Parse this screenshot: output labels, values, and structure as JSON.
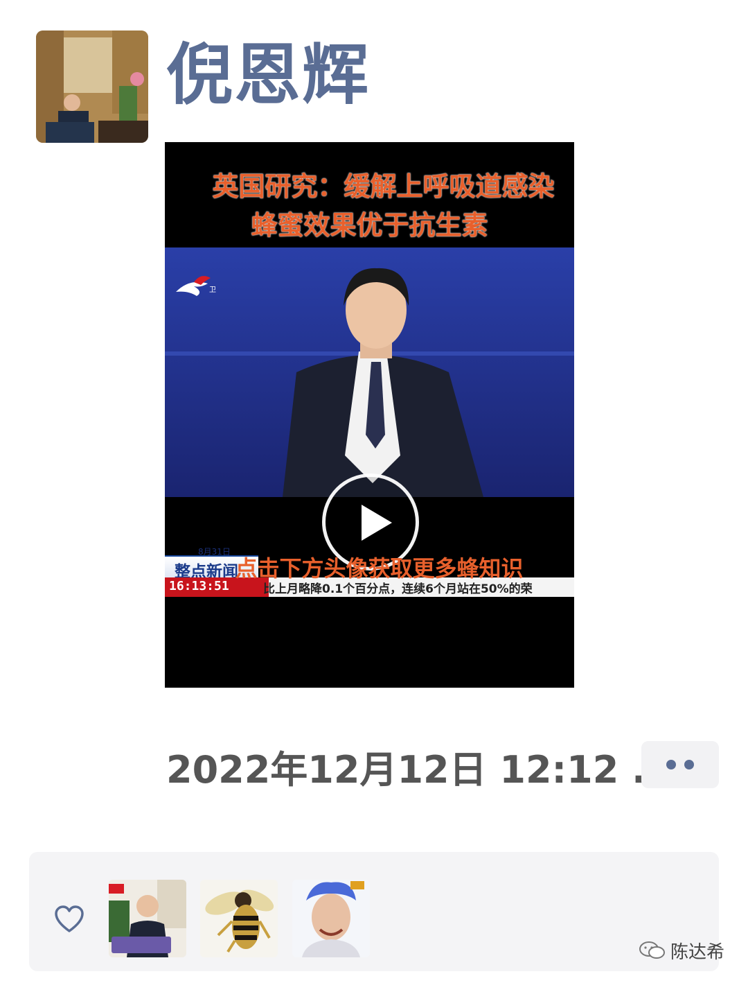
{
  "post": {
    "author": "倪恩辉",
    "timestamp": "2022年12月12日 12:12 ...",
    "avatar_icon": "person-avatar"
  },
  "video": {
    "headline_line1": "英国研究：缓解上呼吸道感染",
    "headline_line2": "蜂蜜效果优于抗生素",
    "news_date": "8月31日",
    "news_program": "整点新闻",
    "ticker_time": "16:13:51",
    "ticker_text": "比上月略降0.1个百分点，连续6个月站在50%的荣",
    "caption": "点击下方头像获取更多蜂知识",
    "play_icon": "play-icon"
  },
  "actions": {
    "more_icon": "more-dots-icon"
  },
  "likes": {
    "heart_icon": "heart-icon",
    "likers": [
      "liker-1",
      "liker-2",
      "liker-3"
    ]
  },
  "watermark": {
    "text": "陈达希",
    "icon": "wechat-icon"
  },
  "colors": {
    "name_blue": "#5a6d94",
    "headline_orange": "#e8602c",
    "ticker_red": "#c8141c"
  }
}
